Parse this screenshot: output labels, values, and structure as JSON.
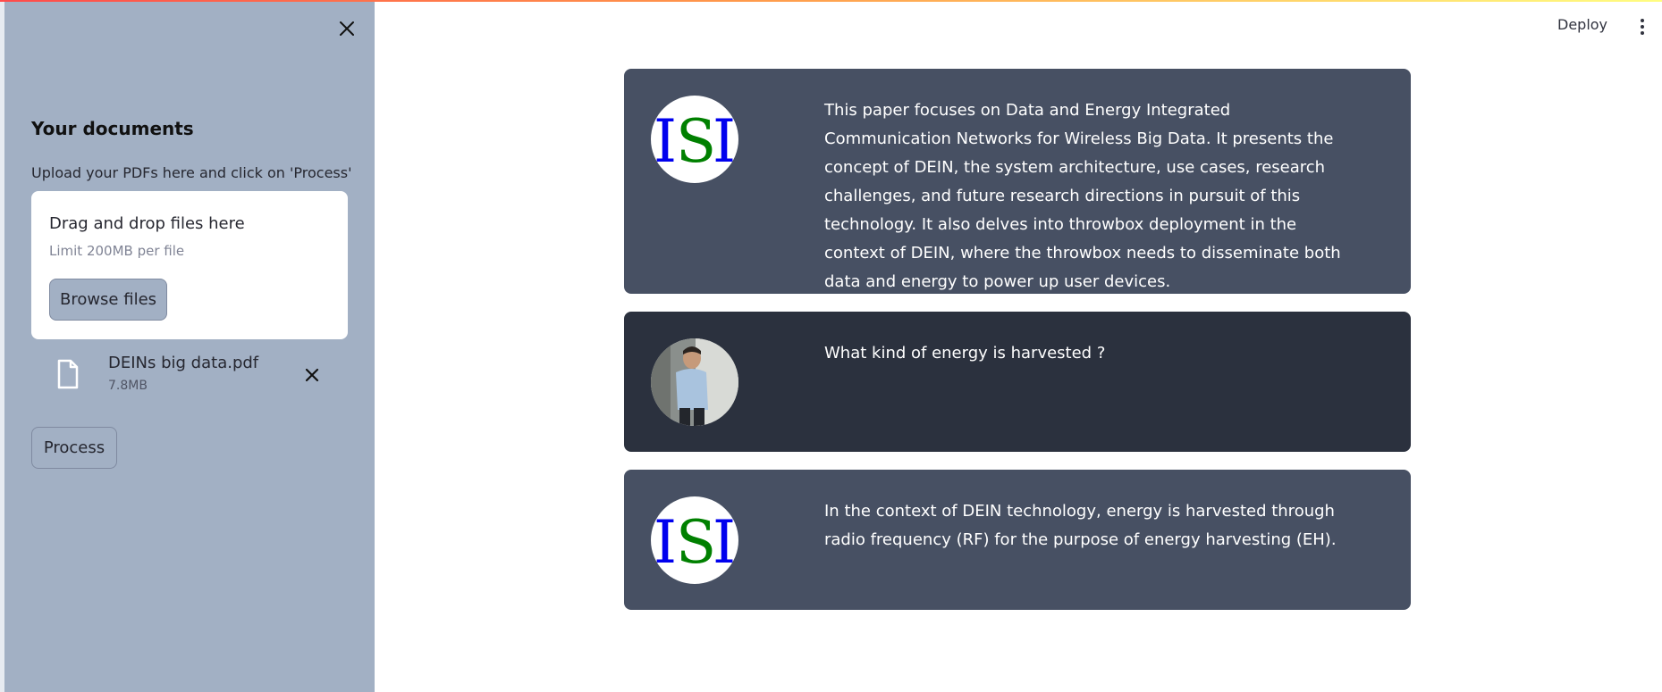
{
  "sidebar": {
    "title": "Your documents",
    "upload_label": "Upload your PDFs here and click on 'Process'",
    "dropzone": {
      "title": "Drag and drop files here",
      "limit": "Limit 200MB per file",
      "browse_label": "Browse files"
    },
    "file": {
      "name": "DEINs big data.pdf",
      "size": "7.8MB"
    },
    "process_label": "Process"
  },
  "header": {
    "deploy_label": "Deploy"
  },
  "chat": {
    "messages": [
      {
        "role": "bot",
        "avatar": "ISI",
        "text": "This paper focuses on Data and Energy Integrated Communication Networks for Wireless Big Data. It presents the concept of DEIN, the system architecture, use cases, research challenges, and future research directions in pursuit of this technology. It also delves into throwbox deployment in the context of DEIN, where the throwbox needs to disseminate both data and energy to power up user devices."
      },
      {
        "role": "user",
        "avatar": "user-photo",
        "text": "What kind of energy is harvested ?"
      },
      {
        "role": "bot",
        "avatar": "ISI",
        "text": "In the context of DEIN technology, energy is harvested through radio frequency (RF) for the purpose of energy harvesting (EH)."
      }
    ]
  },
  "colors": {
    "sidebar_bg": "#a2b0c4",
    "bot_bubble": "#475063",
    "user_bubble": "#2b313e",
    "logo_blue": "#0000ee",
    "logo_green": "#008000"
  },
  "icons": [
    "close-icon",
    "file-icon",
    "remove-file-icon",
    "more-menu-icon"
  ]
}
